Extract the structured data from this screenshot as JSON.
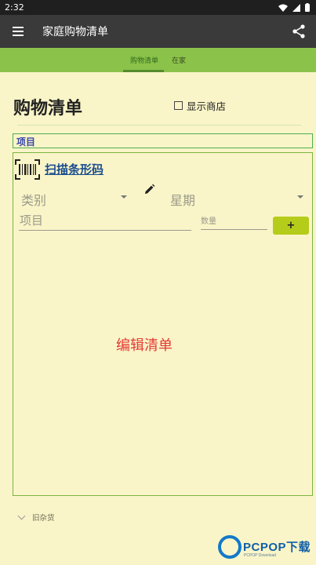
{
  "status_bar": {
    "time": "2:32"
  },
  "app_bar": {
    "title": "家庭购物清单"
  },
  "tabs": [
    {
      "label": "购物清单",
      "active": true
    },
    {
      "label": "在家",
      "active": false
    }
  ],
  "page": {
    "title": "购物清单",
    "show_stores_label": "显示商店",
    "show_stores_checked": false,
    "item_header": "项目"
  },
  "entry": {
    "scan_barcode_label": "扫描条形码",
    "category_placeholder": "类别",
    "day_placeholder": "星期",
    "item_placeholder": "项目",
    "quantity_placeholder": "数量",
    "add_label": "+"
  },
  "list": {
    "edit_label": "编辑清单"
  },
  "footer": {
    "old_goods_label": "旧杂货"
  },
  "watermark": {
    "brand": "PCPOP下载",
    "sub": "PCPOP Download"
  },
  "colors": {
    "background": "#faf5c8",
    "app_bar": "#3a3a3a",
    "tab_bar": "#8bc34a",
    "accent_link": "#1a4d8f",
    "edit_text": "#e53935",
    "add_button": "#b5cc1a"
  }
}
